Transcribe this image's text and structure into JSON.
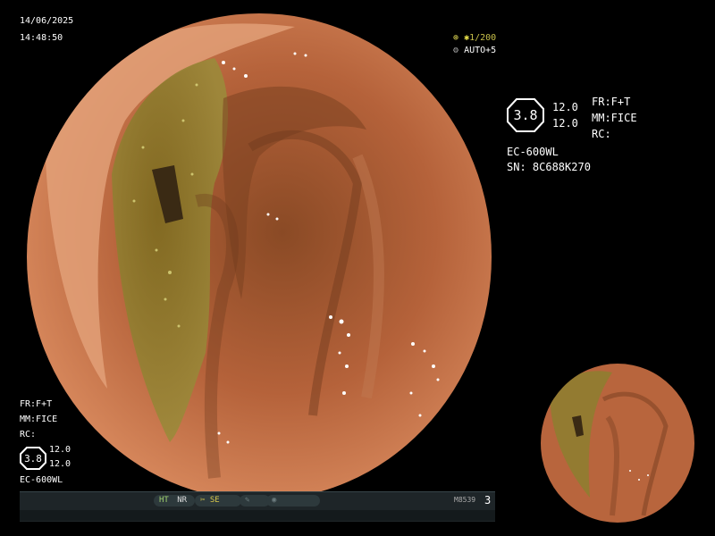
{
  "overlay": {
    "date": "14/06/2025",
    "time": "14:48:50",
    "shutter": "1/200",
    "auto_label": "AUTO+5"
  },
  "right_panel": {
    "structure_value": "3.8",
    "enh_value_1": "12.0",
    "enh_value_2": "12.0",
    "fr": "FR:F+T",
    "mm": "MM:FICE",
    "rc": "RC:",
    "scope_model": "EC-600WL",
    "serial": "SN: 8C688K270"
  },
  "bottom_left": {
    "fr": "FR:F+T",
    "mm": "MM:FICE",
    "rc": "RC:",
    "structure_value": "3.8",
    "enh_value_1": "12.0",
    "enh_value_2": "12.0",
    "scope_model": "EC-600WL"
  },
  "status_bar": {
    "ht": "HT",
    "nr": "NR",
    "se": "SE",
    "code": "M8539",
    "count": "3"
  },
  "icons": [
    "shutter-icon",
    "auto-iris-icon",
    "scissor-icon",
    "pen-icon",
    "record-icon"
  ],
  "colors": {
    "tissue": "#b9633c",
    "bile": "#8a7a2a",
    "status_green": "#9fd06e"
  }
}
